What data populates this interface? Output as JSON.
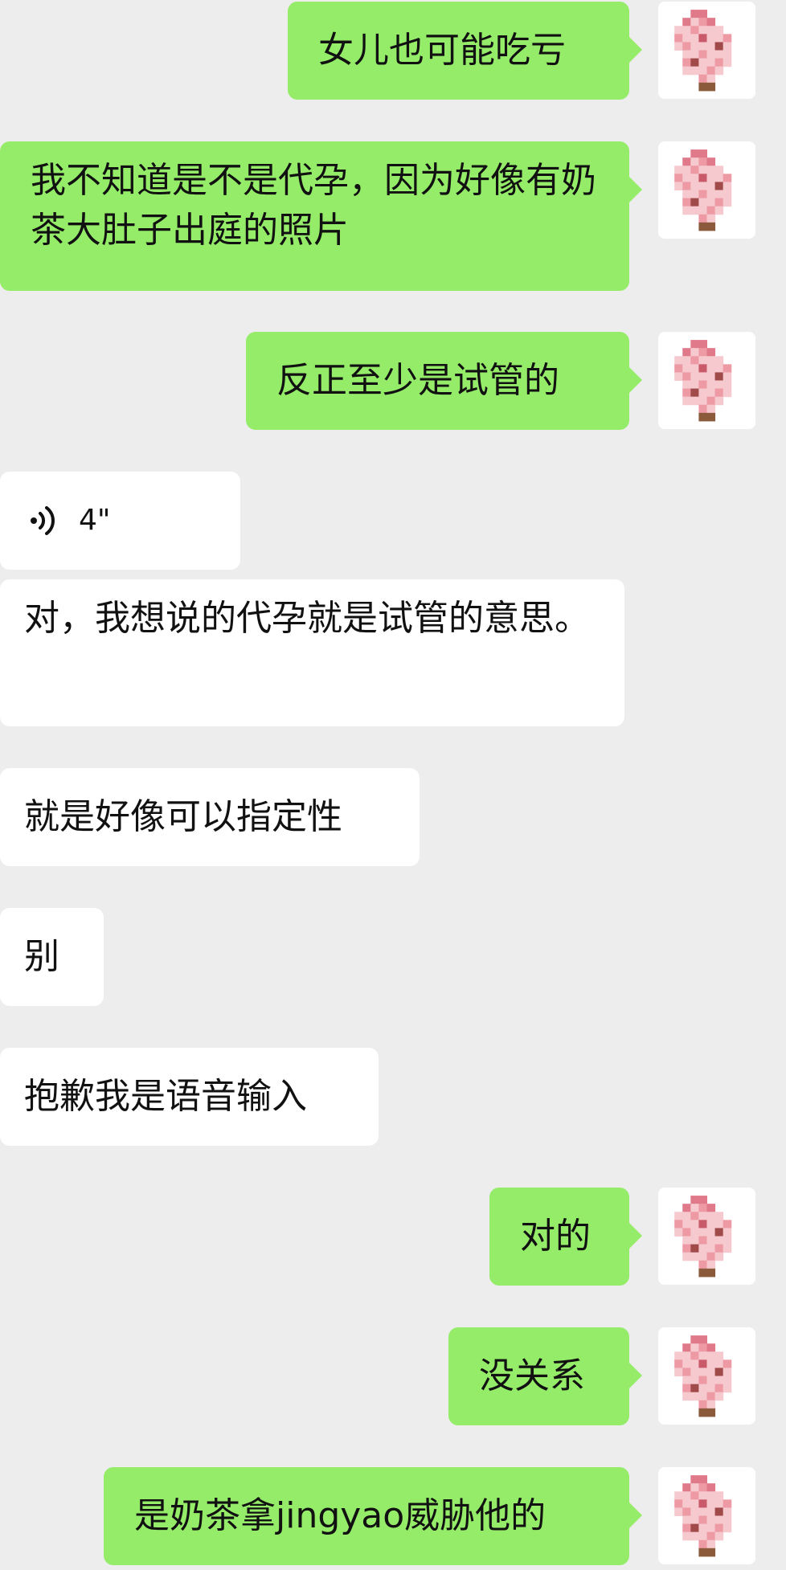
{
  "messages": [
    {
      "direction": "outgoing",
      "type": "text",
      "text": "女儿也可能吃亏"
    },
    {
      "direction": "outgoing",
      "type": "text",
      "text": "我不知道是不是代孕，因为好像有奶茶大肚子出庭的照片"
    },
    {
      "direction": "outgoing",
      "type": "text",
      "text": "反正至少是试管的"
    },
    {
      "direction": "incoming",
      "type": "voice",
      "duration": "4\"",
      "icon": "voice-wave-icon"
    },
    {
      "direction": "incoming",
      "type": "text",
      "text": "对，我想说的代孕就是试管的意思。"
    },
    {
      "direction": "incoming",
      "type": "text",
      "text": "就是好像可以指定性"
    },
    {
      "direction": "incoming",
      "type": "text",
      "text": "别"
    },
    {
      "direction": "incoming",
      "type": "text",
      "text": "抱歉我是语音输入"
    },
    {
      "direction": "outgoing",
      "type": "text",
      "text": "对的"
    },
    {
      "direction": "outgoing",
      "type": "text",
      "text": "没关系"
    },
    {
      "direction": "outgoing",
      "type": "text",
      "text": "是奶茶拿jingyao威胁他的"
    }
  ],
  "colors": {
    "background": "#ededed",
    "outgoing_bubble": "#95ec69",
    "incoming_bubble": "#ffffff",
    "text": "#111111"
  }
}
